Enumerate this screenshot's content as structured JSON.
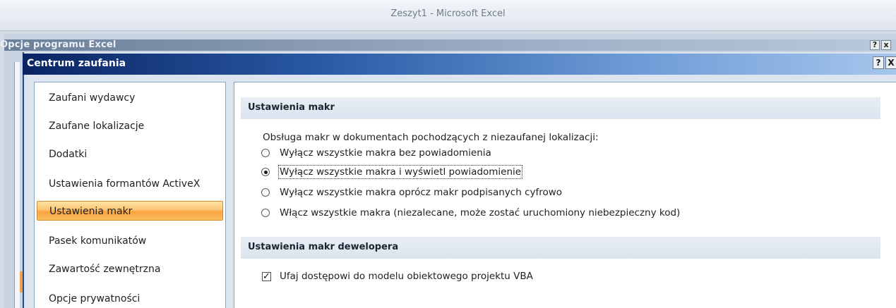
{
  "excel": {
    "title": "Zeszyt1 - Microsoft Excel"
  },
  "options_dialog": {
    "title": "Opcje programu Excel",
    "help_label": "?",
    "close_label": "x"
  },
  "trust_center": {
    "title": "Centrum zaufania",
    "help_label": "?",
    "close_label": "X"
  },
  "nav": {
    "items": [
      {
        "label": "Zaufani wydawcy",
        "selected": false
      },
      {
        "label": "Zaufane lokalizacje",
        "selected": false
      },
      {
        "label": "Dodatki",
        "selected": false
      },
      {
        "label": "Ustawienia formantów ActiveX",
        "selected": false
      },
      {
        "label": "Ustawienia makr",
        "selected": true
      },
      {
        "label": "Pasek komunikatów",
        "selected": false
      },
      {
        "label": "Zawartość zewnętrzna",
        "selected": false
      },
      {
        "label": "Opcje prywatności",
        "selected": false
      }
    ]
  },
  "macro_settings": {
    "header": "Ustawienia makr",
    "description": "Obsługa makr w dokumentach pochodzących z niezaufanej lokalizacji:",
    "options": [
      {
        "label": "Wyłącz wszystkie makra bez powiadomienia",
        "checked": false
      },
      {
        "label": "Wyłącz wszystkie makra i wyświetl powiadomienie",
        "checked": true
      },
      {
        "label": "Wyłącz wszystkie makra oprócz makr podpisanych cyfrowo",
        "checked": false
      },
      {
        "label": "Włącz wszystkie makra (niezalecane, może zostać uruchomiony niebezpieczny kod)",
        "checked": false
      }
    ]
  },
  "developer_settings": {
    "header": "Ustawienia makr dewelopera",
    "trust_vba_label": "Ufaj dostępowi do modelu obiektowego projektu VBA",
    "trust_vba_checked": true,
    "check_mark": "✓"
  }
}
